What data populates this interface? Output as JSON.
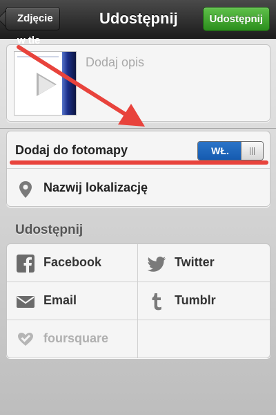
{
  "navbar": {
    "back_label": "Zdjęcie w tle",
    "title": "Udostępnij",
    "share_label": "Udostępnij"
  },
  "media": {
    "caption_placeholder": "Dodaj opis"
  },
  "photomap": {
    "label": "Dodaj do fotomapy",
    "toggle_label": "WŁ.",
    "toggle_state": "on"
  },
  "location": {
    "label": "Nazwij lokalizację"
  },
  "share_section": {
    "title": "Udostępnij",
    "services": [
      {
        "label": "Facebook",
        "icon": "facebook-icon",
        "enabled": true
      },
      {
        "label": "Twitter",
        "icon": "twitter-icon",
        "enabled": true
      },
      {
        "label": "Email",
        "icon": "email-icon",
        "enabled": true
      },
      {
        "label": "Tumblr",
        "icon": "tumblr-icon",
        "enabled": true
      },
      {
        "label": "foursquare",
        "icon": "foursquare-icon",
        "enabled": false
      }
    ]
  },
  "colors": {
    "share_button": "#3da52a",
    "toggle_on": "#1f66bd",
    "annotation": "#e8433c"
  }
}
